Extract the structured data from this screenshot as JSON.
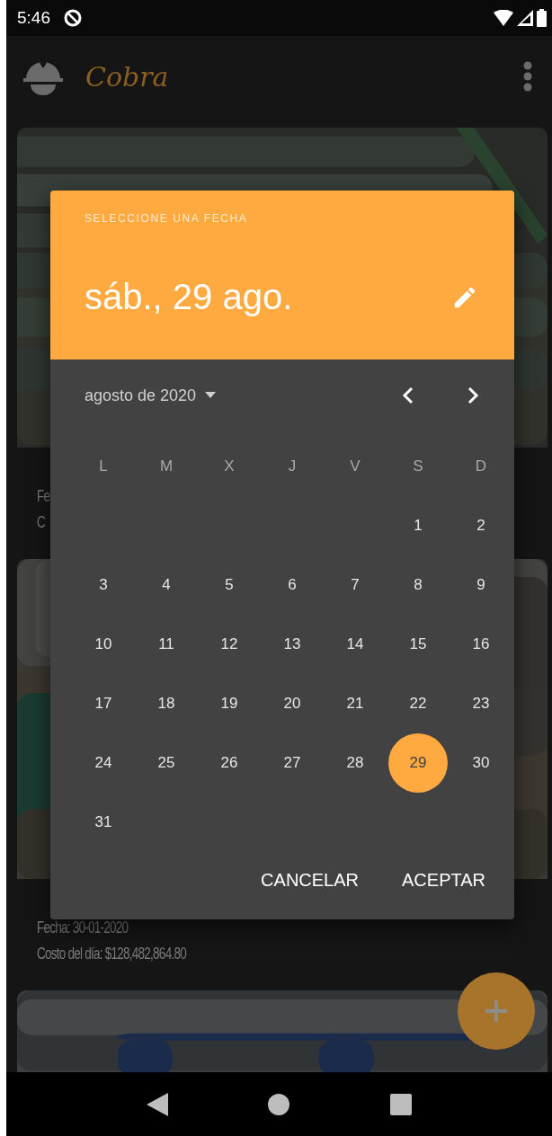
{
  "status_bar": {
    "time": "5:46"
  },
  "app_bar": {
    "title": "Cobra"
  },
  "cards": [
    {
      "kind": "picture",
      "lines": [
        "Fe",
        "C"
      ]
    },
    {
      "kind": "picture",
      "lines": [
        "Fecha: 30-01-2020",
        "Costo del día:  $128,482,864.80"
      ]
    },
    {
      "kind": "picture"
    }
  ],
  "date_dialog": {
    "header_label": "SELECCIONE UNA FECHA",
    "selected_date": "sáb., 29 ago.",
    "month_label": "agosto de 2020",
    "weekdays": [
      "L",
      "M",
      "X",
      "J",
      "V",
      "S",
      "D"
    ],
    "weeks": [
      [
        {
          "day": "1",
          "selected": false
        },
        {
          "day": "2",
          "selected": false
        }
      ],
      [
        {
          "day": "3",
          "selected": false
        },
        {
          "day": "4",
          "selected": false
        },
        {
          "day": "5",
          "selected": false
        },
        {
          "day": "6",
          "selected": false
        },
        {
          "day": "7",
          "selected": false
        },
        {
          "day": "8",
          "selected": false
        },
        {
          "day": "9",
          "selected": false
        }
      ],
      [
        {
          "day": "10",
          "selected": false
        },
        {
          "day": "11",
          "selected": false
        },
        {
          "day": "12",
          "selected": false
        },
        {
          "day": "13",
          "selected": false
        },
        {
          "day": "14",
          "selected": false
        },
        {
          "day": "15",
          "selected": false
        },
        {
          "day": "16",
          "selected": false
        }
      ],
      [
        {
          "day": "17",
          "selected": false
        },
        {
          "day": "18",
          "selected": false
        },
        {
          "day": "19",
          "selected": false
        },
        {
          "day": "20",
          "selected": false
        },
        {
          "day": "21",
          "selected": false
        },
        {
          "day": "22",
          "selected": false
        },
        {
          "day": "23",
          "selected": false
        }
      ],
      [
        {
          "day": "24",
          "selected": false
        },
        {
          "day": "25",
          "selected": false
        },
        {
          "day": "26",
          "selected": false
        },
        {
          "day": "27",
          "selected": false
        },
        {
          "day": "28",
          "selected": false
        },
        {
          "day": "29",
          "selected": true
        },
        {
          "day": "30",
          "selected": false
        }
      ],
      [
        {
          "day": "31",
          "selected": false
        }
      ]
    ],
    "buttons": [
      "CANCELAR",
      "ACEPTAR"
    ]
  }
}
